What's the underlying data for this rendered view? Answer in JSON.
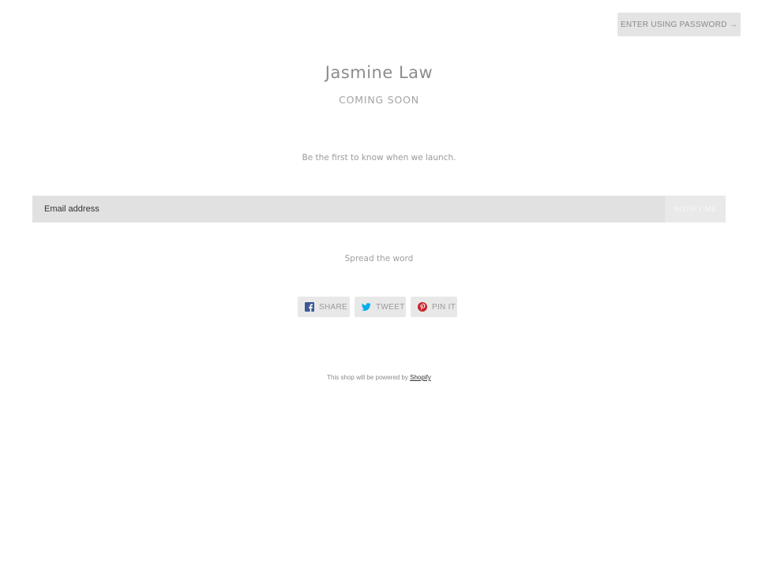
{
  "header": {
    "enter_password_label": "ENTER USING PASSWORD →"
  },
  "shop": {
    "title": "Jasmine Law",
    "subtitle": "COMING SOON",
    "tagline": "Be the first to know when we launch."
  },
  "signup": {
    "email_placeholder": "Email address",
    "email_value": "",
    "notify_label": "NOTIFY ME"
  },
  "share": {
    "heading": "Spread the word",
    "buttons": [
      {
        "label": "SHARE",
        "icon": "facebook-icon",
        "color": "#3b5998"
      },
      {
        "label": "TWEET",
        "icon": "twitter-icon",
        "color": "#00aced"
      },
      {
        "label": "PIN IT",
        "icon": "pinterest-icon",
        "color": "#cb2127"
      }
    ]
  },
  "footer": {
    "powered_text": "This shop will be powered by",
    "powered_link": "Shopify"
  }
}
